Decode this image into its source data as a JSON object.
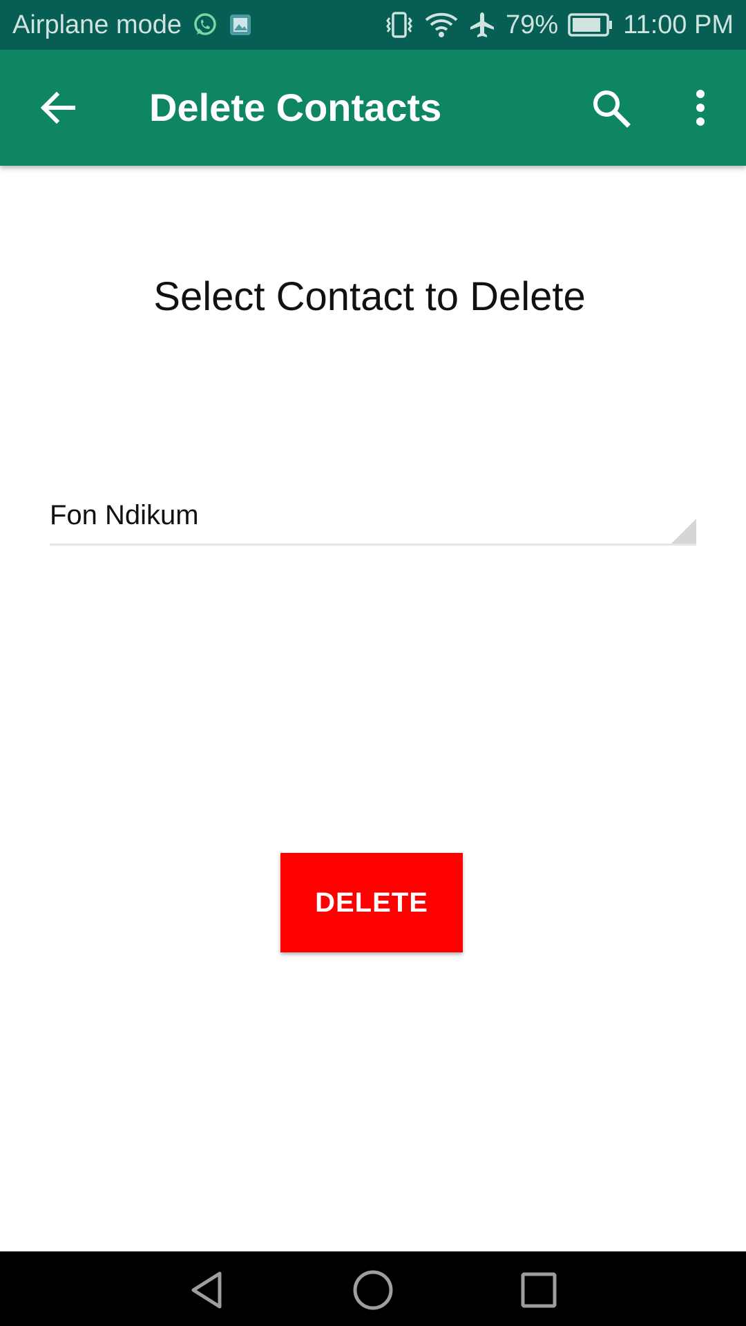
{
  "status_bar": {
    "mode_text": "Airplane mode",
    "battery_text": "79%",
    "time": "11:00 PM",
    "icons": [
      "whatsapp-icon",
      "gallery-icon",
      "vibrate-icon",
      "wifi-icon",
      "airplane-icon",
      "battery-icon"
    ],
    "color": "#075e54"
  },
  "app_bar": {
    "title": "Delete Contacts",
    "color": "#0f8663",
    "icons": [
      "back-arrow-icon",
      "search-icon",
      "more-vert-icon"
    ]
  },
  "main": {
    "heading": "Select Contact to Delete",
    "contact_spinner": {
      "selected_value": "Fon Ndikum"
    },
    "delete_button": {
      "label": "DELETE",
      "color": "#ff0000"
    }
  },
  "nav_bar": {
    "icons": [
      "back-triangle-icon",
      "home-circle-icon",
      "recents-square-icon"
    ]
  }
}
